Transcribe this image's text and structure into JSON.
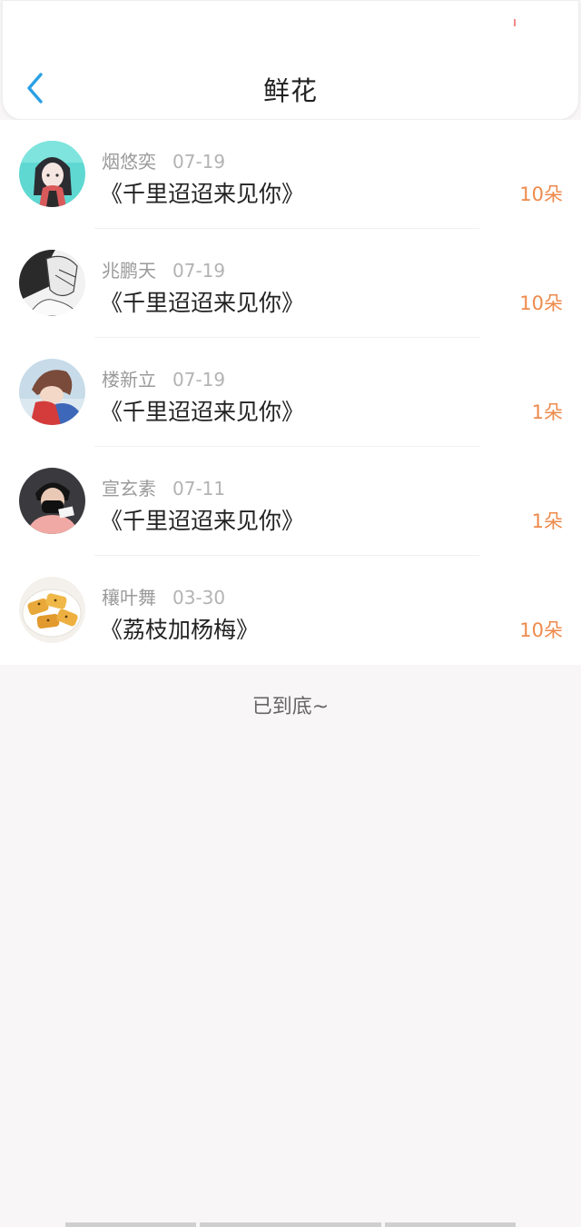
{
  "header": {
    "title": "鲜花",
    "back_icon": "chevron-left-icon",
    "accent_color": "#2aa0e6"
  },
  "items": [
    {
      "name": "烟悠奕",
      "date": "07-19",
      "book": "《千里迢迢来见你》",
      "count": "10朵",
      "avatar": "anime-girl-teal"
    },
    {
      "name": "兆鹏天",
      "date": "07-19",
      "book": "《千里迢迢来见你》",
      "count": "10朵",
      "avatar": "sketch-boy"
    },
    {
      "name": "楼新立",
      "date": "07-19",
      "book": "《千里迢迢来见你》",
      "count": "1朵",
      "avatar": "anime-boy-red"
    },
    {
      "name": "宣玄素",
      "date": "07-11",
      "book": "《千里迢迢来见你》",
      "count": "1朵",
      "avatar": "masked-person"
    },
    {
      "name": "穰叶舞",
      "date": "03-30",
      "book": "《荔枝加杨梅》",
      "count": "10朵",
      "avatar": "food-photo"
    }
  ],
  "footer": {
    "end_text": "已到底~"
  },
  "colors": {
    "count": "#ee8a4c",
    "background": "#f8f6f7"
  }
}
